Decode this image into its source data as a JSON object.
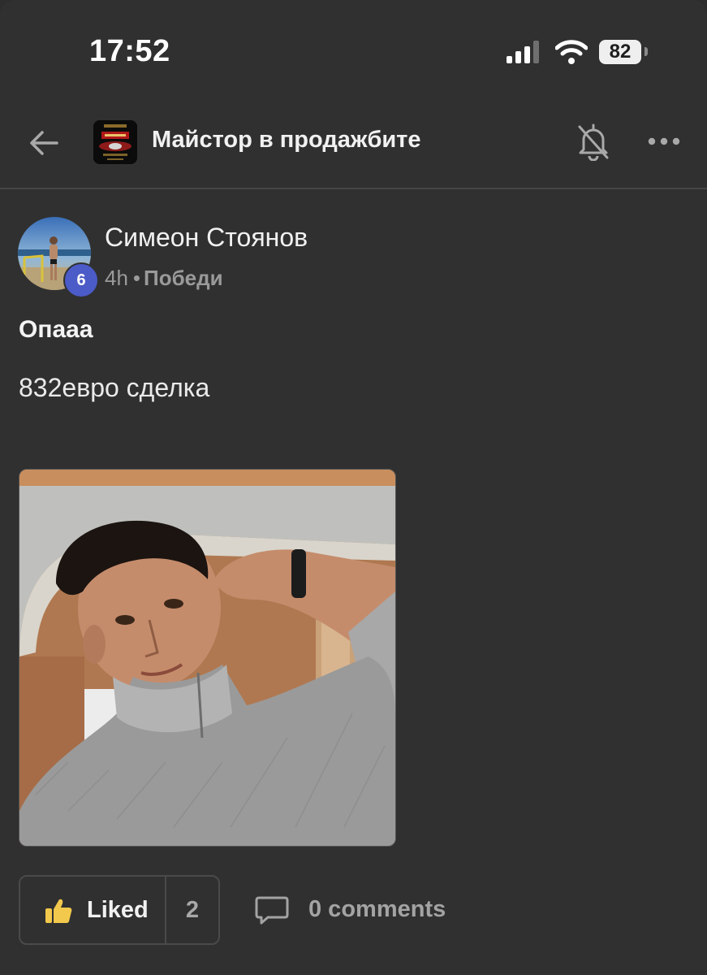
{
  "status_bar": {
    "time": "17:52",
    "battery": "82"
  },
  "header": {
    "group_name": "Майстор в продажбите",
    "icons": [
      "back-arrow-icon",
      "group-logo",
      "bell-off-icon",
      "more-icon"
    ]
  },
  "post": {
    "author": "Симеон Стоянов",
    "level": "6",
    "time_ago": "4h",
    "separator": "•",
    "category": "Победи",
    "title": "Опааа",
    "body": "832евро сделка"
  },
  "actions": {
    "like_label": "Liked",
    "like_count": "2",
    "comments_label": "0 comments"
  },
  "colors": {
    "background": "#303030",
    "level_badge": "#4b5bc7",
    "like_icon": "#f2c94c",
    "muted_text": "#9a9a9a"
  }
}
